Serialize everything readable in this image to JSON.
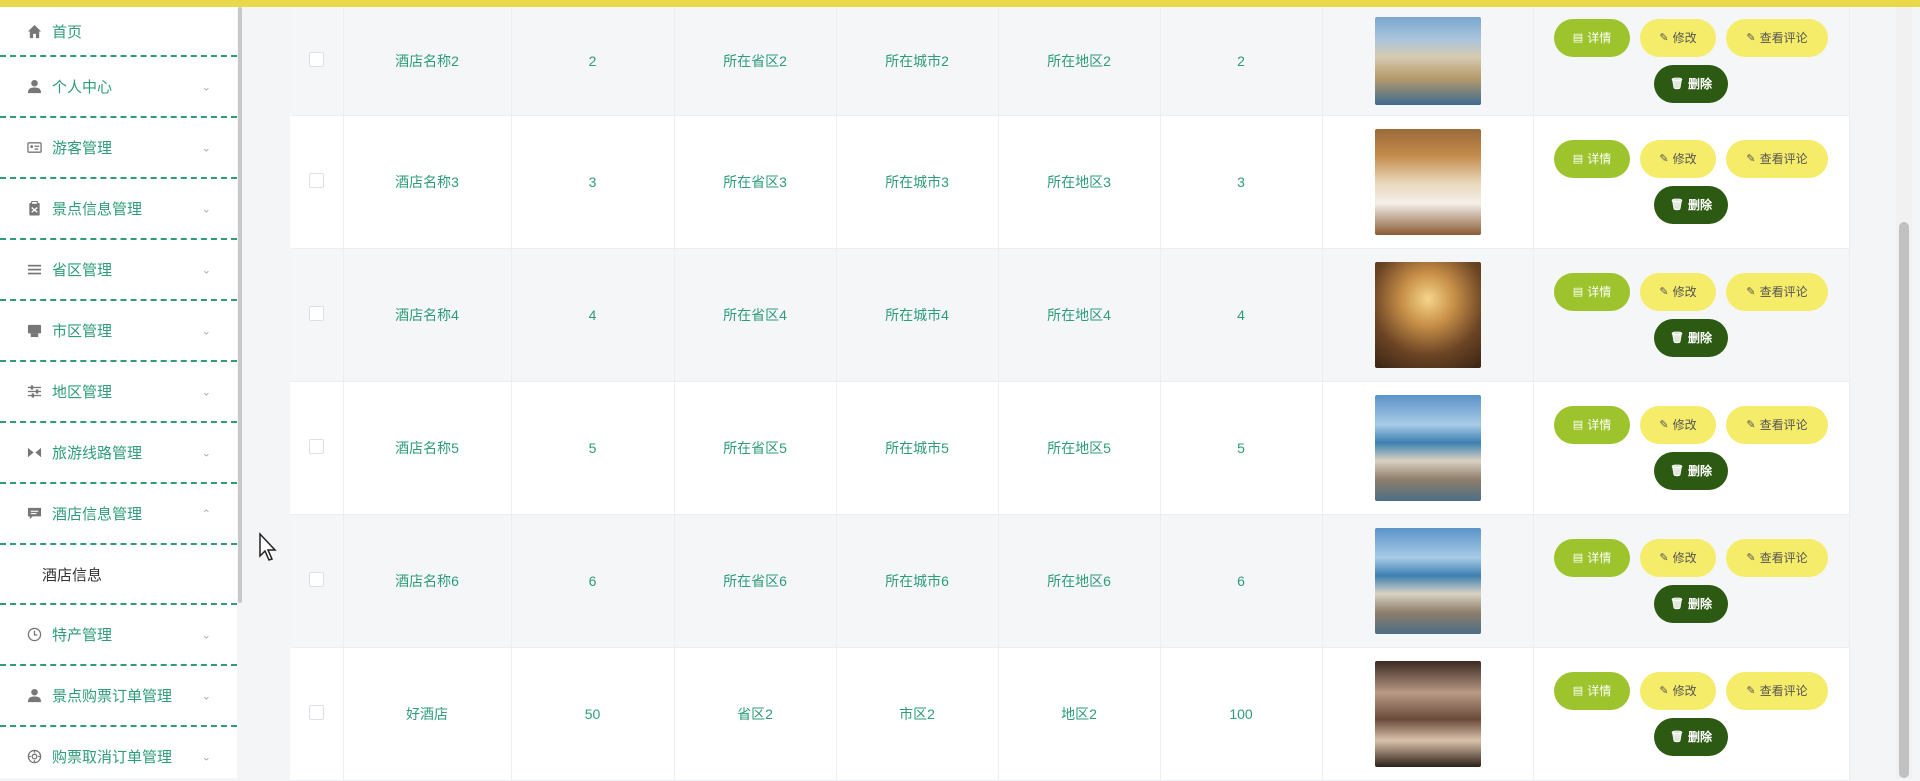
{
  "colors": {
    "accent": "#2e9c7a",
    "topbar": "#e8d84a",
    "detail_btn": "#9dc42c",
    "edit_btn": "#f5ec6a",
    "delete_btn": "#2c5a12"
  },
  "sidebar": {
    "items": [
      {
        "label": "首页",
        "icon": "home-icon",
        "chevron": ""
      },
      {
        "label": "个人中心",
        "icon": "user-icon",
        "chevron": "⌄"
      },
      {
        "label": "游客管理",
        "icon": "id-card-icon",
        "chevron": "⌄"
      },
      {
        "label": "景点信息管理",
        "icon": "clipboard-icon",
        "chevron": "⌄"
      },
      {
        "label": "省区管理",
        "icon": "list-icon",
        "chevron": "⌄"
      },
      {
        "label": "市区管理",
        "icon": "printer-icon",
        "chevron": "⌄"
      },
      {
        "label": "地区管理",
        "icon": "sliders-icon",
        "chevron": "⌄"
      },
      {
        "label": "旅游线路管理",
        "icon": "route-icon",
        "chevron": "⌄"
      },
      {
        "label": "酒店信息管理",
        "icon": "chat-icon",
        "chevron": "⌃"
      }
    ],
    "sub_item": "酒店信息",
    "items_after": [
      {
        "label": "特产管理",
        "icon": "clock-icon",
        "chevron": "⌄"
      },
      {
        "label": "景点购票订单管理",
        "icon": "user-icon",
        "chevron": "⌄"
      },
      {
        "label": "购票取消订单管理",
        "icon": "target-icon",
        "chevron": "⌄"
      }
    ]
  },
  "table": {
    "rows": [
      {
        "name": "酒店名称2",
        "id": "2",
        "province": "所在省区2",
        "city": "所在城市2",
        "district": "所在地区2",
        "num": "2",
        "thumb": "hotel-exterior"
      },
      {
        "name": "酒店名称3",
        "id": "3",
        "province": "所在省区3",
        "city": "所在城市3",
        "district": "所在地区3",
        "num": "3",
        "thumb": "hotel-room"
      },
      {
        "name": "酒店名称4",
        "id": "4",
        "province": "所在省区4",
        "city": "所在城市4",
        "district": "所在地区4",
        "num": "4",
        "thumb": "hotel-hall"
      },
      {
        "name": "酒店名称5",
        "id": "5",
        "province": "所在省区5",
        "city": "所在城市5",
        "district": "所在地区5",
        "num": "5",
        "thumb": "hotel-seaview"
      },
      {
        "name": "酒店名称6",
        "id": "6",
        "province": "所在省区6",
        "city": "所在城市6",
        "district": "所在地区6",
        "num": "6",
        "thumb": "hotel-seaview"
      },
      {
        "name": "好酒店",
        "id": "50",
        "province": "省区2",
        "city": "市区2",
        "district": "地区2",
        "num": "100",
        "thumb": "hotel-lobby"
      }
    ],
    "actions": {
      "detail": "详情",
      "edit": "修改",
      "review": "查看评论",
      "delete": "删除"
    }
  }
}
